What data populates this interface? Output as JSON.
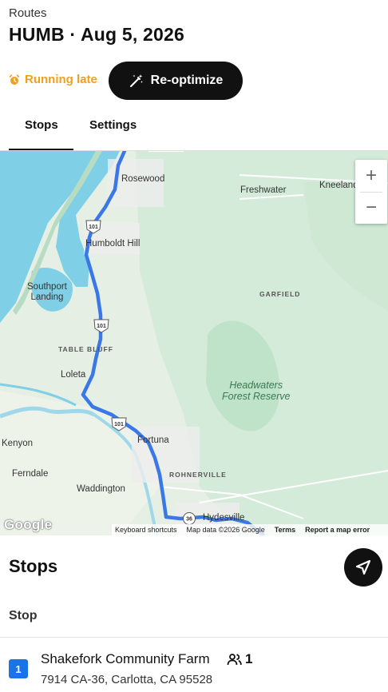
{
  "header": {
    "breadcrumb": "Routes",
    "title": "HUMB · Aug 5, 2026"
  },
  "status": {
    "late_label": "Running late",
    "reoptimize_label": "Re-optimize",
    "late_color": "#f0a020"
  },
  "tabs": [
    {
      "label": "Stops",
      "active": true
    },
    {
      "label": "Settings",
      "active": false
    }
  ],
  "map": {
    "places": {
      "rosewood": "Rosewood",
      "freshwater": "Freshwater",
      "kneeland": "Kneeland",
      "humboldt_hill": "Humboldt Hill",
      "southport": "Southport\nLanding",
      "garfield": "GARFIELD",
      "table_bluff": "TABLE BLUFF",
      "loleta": "Loleta",
      "headwaters": "Headwaters\nForest Reserve",
      "kenyon": "Kenyon",
      "fortuna": "Fortuna",
      "ferndale": "Ferndale",
      "rohnerville": "ROHNERVILLE",
      "waddington": "Waddington",
      "hydesville": "Hydesville"
    },
    "shields": [
      "101",
      "101",
      "101",
      "36"
    ],
    "zoom_in": "+",
    "zoom_out": "−",
    "logo": "Google",
    "footer": {
      "shortcuts": "Keyboard shortcuts",
      "data": "Map data ©2026 Google",
      "terms": "Terms",
      "report": "Report a map error"
    },
    "route_color": "#3b78e7"
  },
  "stops_section": {
    "title": "Stops",
    "column_header": "Stop",
    "items": [
      {
        "number": "1",
        "name": "Shakefork Community Farm",
        "people_count": "1",
        "address": "7914 CA-36, Carlotta, CA 95528"
      }
    ]
  },
  "icons": {
    "late": "alarm-clock-icon",
    "reoptimize": "magic-wand-icon",
    "navigate": "navigation-arrow-icon",
    "people": "people-icon"
  }
}
